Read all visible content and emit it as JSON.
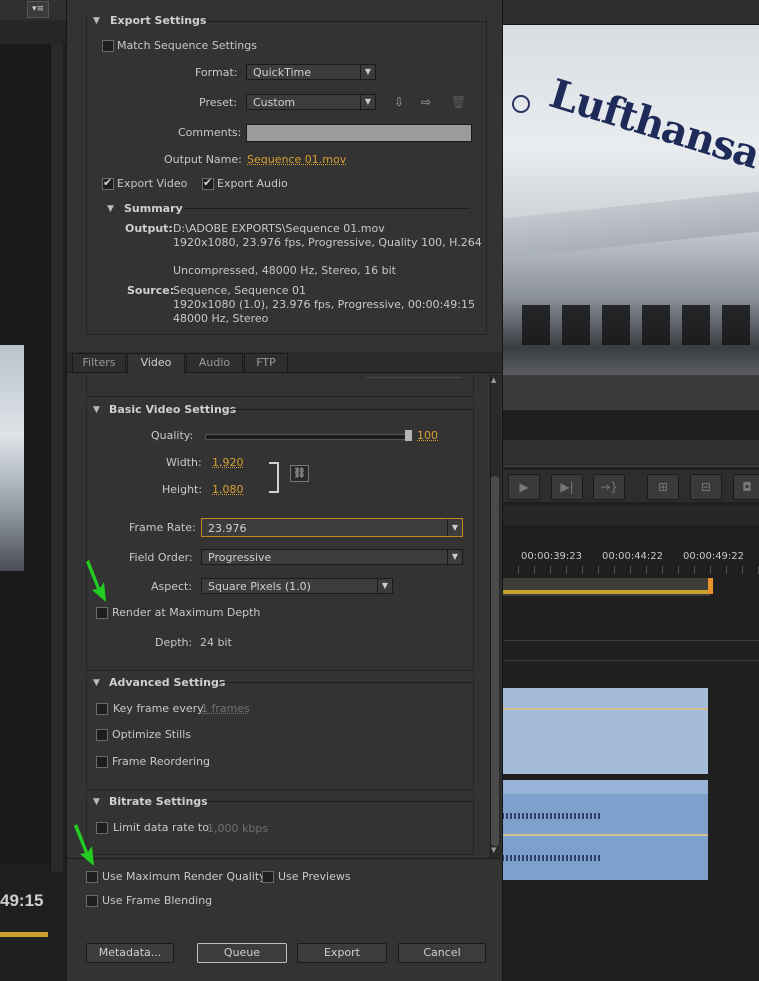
{
  "left_panel": {
    "menu_icon": "panel-menu-icon",
    "timecode": "49:15"
  },
  "dialog": {
    "export_settings": {
      "title": "Export Settings",
      "match_sequence": "Match Sequence Settings",
      "format_label": "Format:",
      "format_value": "QuickTime",
      "preset_label": "Preset:",
      "preset_value": "Custom",
      "comments_label": "Comments:",
      "comments_value": "",
      "output_name_label": "Output Name:",
      "output_name_value": "Sequence 01.mov",
      "export_video": "Export Video",
      "export_audio": "Export Audio",
      "summary": {
        "title": "Summary",
        "output_label": "Output:",
        "output_line1": "D:\\ADOBE EXPORTS\\Sequence 01.mov",
        "output_line2": "1920x1080, 23.976 fps, Progressive, Quality 100, H.264",
        "output_line3": "Uncompressed, 48000 Hz, Stereo, 16 bit",
        "source_label": "Source:",
        "source_line1": "Sequence, Sequence 01",
        "source_line2": "1920x1080 (1.0), 23.976 fps, Progressive, 00:00:49:15",
        "source_line3": "48000 Hz, Stereo"
      }
    },
    "tabs": [
      "Filters",
      "Video",
      "Audio",
      "FTP"
    ],
    "basic_video": {
      "title": "Basic Video Settings",
      "quality_label": "Quality:",
      "quality_value": "100",
      "quality_level": 1.0,
      "width_label": "Width:",
      "width_value": "1,920",
      "height_label": "Height:",
      "height_value": "1,080",
      "frame_rate_label": "Frame Rate:",
      "frame_rate_value": "23.976",
      "field_order_label": "Field Order:",
      "field_order_value": "Progressive",
      "aspect_label": "Aspect:",
      "aspect_value": "Square Pixels (1.0)",
      "render_max_depth": "Render at Maximum Depth",
      "depth_label": "Depth:",
      "depth_value": "24 bit"
    },
    "advanced": {
      "title": "Advanced Settings",
      "key_frame": "Key frame every",
      "key_frame_value": "1 frames",
      "optimize_stills": "Optimize Stills",
      "frame_reordering": "Frame Reordering"
    },
    "bitrate": {
      "title": "Bitrate Settings",
      "limit_rate": "Limit data rate to",
      "limit_rate_value": "1,000 kbps"
    },
    "footer": {
      "use_max_render": "Use Maximum Render Quality",
      "use_previews": "Use Previews",
      "use_frame_blending": "Use Frame Blending",
      "metadata": "Metadata...",
      "queue": "Queue",
      "export": "Export",
      "cancel": "Cancel"
    }
  },
  "right_panel": {
    "preview_text": "Lufthansa",
    "timecodes": [
      "00:00:39:23",
      "00:00:44:22",
      "00:00:49:22"
    ]
  },
  "colors": {
    "accent": "#d6a030",
    "dialog_bg": "#333333",
    "arrow": "#22cc22"
  }
}
